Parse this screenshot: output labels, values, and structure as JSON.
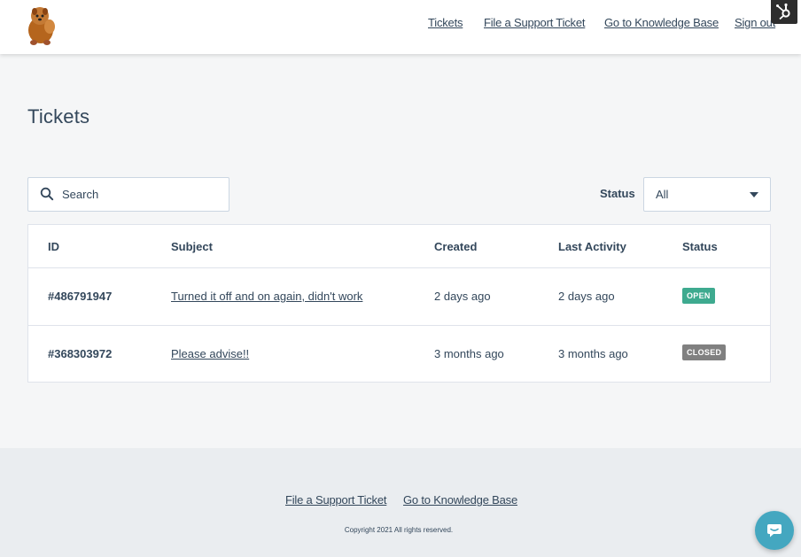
{
  "header": {
    "nav": [
      "Tickets",
      "File a Support Ticket",
      "Go to Knowledge Base",
      "Sign out"
    ]
  },
  "main": {
    "title": "Tickets",
    "search": {
      "placeholder": "Search"
    },
    "status_filter": {
      "label": "Status",
      "value": "All"
    },
    "table": {
      "columns": [
        "ID",
        "Subject",
        "Created",
        "Last Activity",
        "Status"
      ],
      "rows": [
        {
          "id": "#486791947",
          "subject": "Turned it off and on again, didn't work",
          "created": "2 days ago",
          "last_activity": "2 days ago",
          "status": "OPEN",
          "status_color": "#3eaa8f"
        },
        {
          "id": "#368303972",
          "subject": "Please advise!!",
          "created": "3 months ago",
          "last_activity": "3 months ago",
          "status": "CLOSED",
          "status_color": "#808080"
        }
      ]
    }
  },
  "footer": {
    "links": [
      "File a Support Ticket",
      "Go to Knowledge Base"
    ],
    "copyright": "Copyright 2021 All rights reserved."
  },
  "icons": {
    "logo": "pomeranian-dog-logo",
    "hubspot": "hubspot-sprocket-icon",
    "search": "search-icon",
    "chat": "chat-bubble-icon",
    "caret": "caret-down-icon"
  },
  "colors": {
    "text": "#33475b",
    "open": "#3eaa8f",
    "closed": "#808080",
    "chat": "#44a7c0"
  }
}
